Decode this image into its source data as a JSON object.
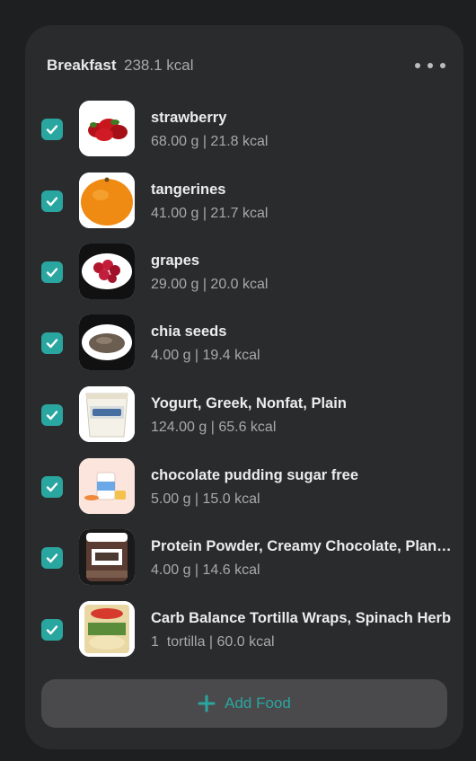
{
  "meal": {
    "title": "Breakfast",
    "kcal": "238.1 kcal"
  },
  "icons": {
    "more": "more-horizontal-icon",
    "check": "check-icon",
    "add": "plus-icon"
  },
  "colors": {
    "accent": "#2aa6a0",
    "card_bg": "#2a2b2d",
    "page_bg": "#1e1f21"
  },
  "foods": [
    {
      "name": "strawberry",
      "meta": "68.00 g | 21.8 kcal",
      "checked": true
    },
    {
      "name": "tangerines",
      "meta": "41.00 g | 21.7 kcal",
      "checked": true
    },
    {
      "name": "grapes",
      "meta": "29.00 g | 20.0 kcal",
      "checked": true
    },
    {
      "name": "chia seeds",
      "meta": "4.00 g | 19.4 kcal",
      "checked": true
    },
    {
      "name": "Yogurt, Greek, Nonfat, Plain",
      "meta": "124.00 g | 65.6 kcal",
      "checked": true
    },
    {
      "name": "chocolate pudding sugar free",
      "meta": "5.00 g | 15.0 kcal",
      "checked": true
    },
    {
      "name": "Protein Powder, Creamy Chocolate, Plan…",
      "meta": "4.00 g | 14.6 kcal",
      "checked": true
    },
    {
      "name": "Carb Balance Tortilla Wraps, Spinach Herb",
      "meta": "1  tortilla | 60.0 kcal",
      "checked": true
    }
  ],
  "add_food": {
    "label": "Add Food"
  }
}
